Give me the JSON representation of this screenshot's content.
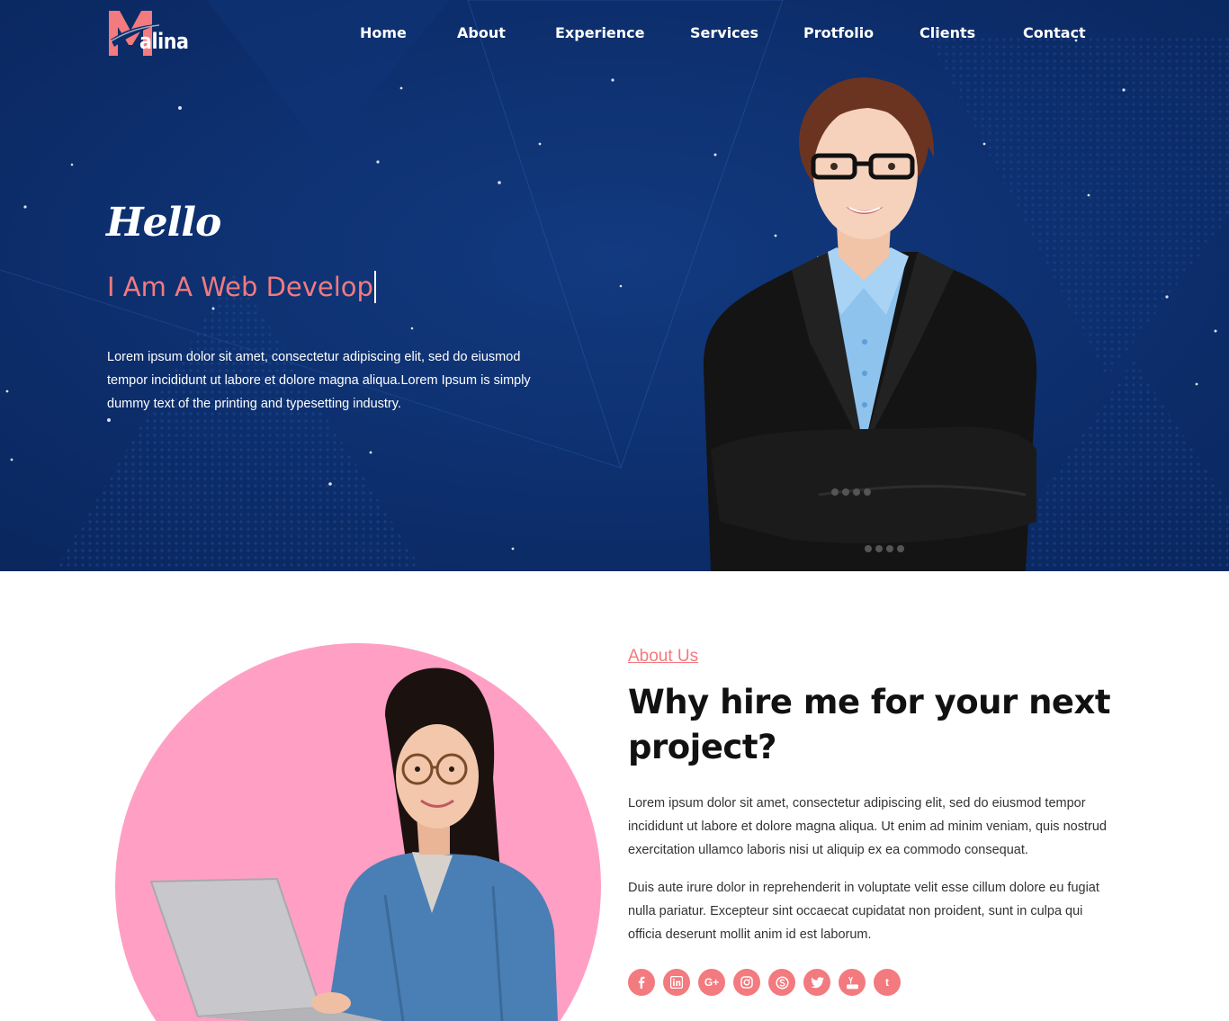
{
  "brand": {
    "logo_letter": "M",
    "logo_text": "alina"
  },
  "nav": {
    "items": [
      {
        "label": "Home"
      },
      {
        "label": "About"
      },
      {
        "label": "Experience"
      },
      {
        "label": "Services"
      },
      {
        "label": "Protfolio"
      },
      {
        "label": "Clients"
      },
      {
        "label": "Contact"
      }
    ]
  },
  "hero": {
    "greeting": "Hello",
    "role_text": "I Am A Web Develop",
    "description": "Lorem ipsum dolor sit amet, consectetur adipiscing elit, sed do eiusmod tempor incididunt ut labore et dolore magna aliqua.Lorem Ipsum is simply dummy text of the printing and typesetting industry."
  },
  "about": {
    "label": "About Us",
    "title": "Why hire me for your next project?",
    "paragraph_1": "Lorem ipsum dolor sit amet, consectetur adipiscing elit, sed do eiusmod tempor incididunt ut labore et dolore magna aliqua. Ut enim ad minim veniam, quis nostrud exercitation ullamco laboris nisi ut aliquip ex ea commodo consequat.",
    "paragraph_2": "Duis aute irure dolor in reprehenderit in voluptate velit esse cillum dolore eu fugiat nulla pariatur. Excepteur sint occaecat cupidatat non proident, sunt in culpa qui officia deserunt mollit anim id est laborum."
  },
  "social": [
    {
      "icon": "facebook-icon",
      "glyph": "f"
    },
    {
      "icon": "linkedin-icon",
      "glyph": "in"
    },
    {
      "icon": "google-plus-icon",
      "glyph": "G+"
    },
    {
      "icon": "instagram-icon",
      "glyph": ""
    },
    {
      "icon": "skype-icon",
      "glyph": "S"
    },
    {
      "icon": "twitter-icon",
      "glyph": ""
    },
    {
      "icon": "youtube-icon",
      "glyph": ""
    },
    {
      "icon": "tumblr-icon",
      "glyph": "t"
    }
  ],
  "colors": {
    "hero_bg": "#0c2d6b",
    "accent": "#f37a7e",
    "about_circle": "#ff9fc3",
    "heading": "#111111",
    "body_text": "#333333"
  }
}
